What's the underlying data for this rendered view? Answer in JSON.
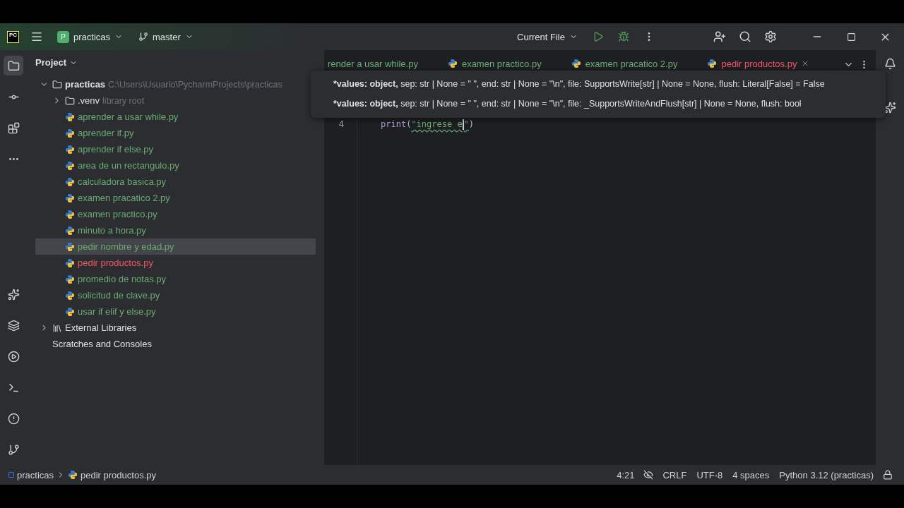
{
  "title_bar": {
    "logo": "PC",
    "project_badge": "P",
    "project": "practicas",
    "branch": "master",
    "run_config": "Current File"
  },
  "project_panel": {
    "title": "Project",
    "tree": [
      {
        "kind": "folder",
        "name": "practicas",
        "hint": "C:\\Users\\Usuario\\PycharmProjects\\practicas",
        "expanded": true,
        "selected": false,
        "children": [
          {
            "kind": "folder",
            "name": ".venv",
            "hint": "library root",
            "expanded": false,
            "selected": false
          },
          {
            "kind": "file",
            "name": "aprender a usar while.py",
            "color": "#6aab73",
            "selected": false
          },
          {
            "kind": "file",
            "name": "aprender if.py",
            "color": "#6aab73",
            "selected": false
          },
          {
            "kind": "file",
            "name": "aprender if else.py",
            "color": "#6aab73",
            "selected": false
          },
          {
            "kind": "file",
            "name": "area de un rectangulo.py",
            "color": "#6aab73",
            "selected": false
          },
          {
            "kind": "file",
            "name": "calculadora basica.py",
            "color": "#6aab73",
            "selected": false
          },
          {
            "kind": "file",
            "name": "examen pracatico 2.py",
            "color": "#6aab73",
            "selected": false
          },
          {
            "kind": "file",
            "name": "examen practico.py",
            "color": "#6aab73",
            "selected": false
          },
          {
            "kind": "file",
            "name": "minuto a hora.py",
            "color": "#6aab73",
            "selected": false
          },
          {
            "kind": "file",
            "name": "pedir nombre y edad.py",
            "color": "#6aab73",
            "selected": true
          },
          {
            "kind": "file",
            "name": "pedir productos.py",
            "color": "#f75464",
            "selected": false
          },
          {
            "kind": "file",
            "name": "promedio de notas.py",
            "color": "#6aab73",
            "selected": false
          },
          {
            "kind": "file",
            "name": "solicitud de clave.py",
            "color": "#6aab73",
            "selected": false
          },
          {
            "kind": "file",
            "name": "usar if elif y else.py",
            "color": "#6aab73",
            "selected": false
          }
        ]
      },
      {
        "kind": "library",
        "name": "External Libraries",
        "expanded": false,
        "selected": false
      },
      {
        "kind": "scratch",
        "name": "Scratches and Consoles",
        "selected": false
      }
    ]
  },
  "tabs": [
    {
      "label": "render a usar while.py",
      "icon": false,
      "selected": false,
      "color": "#6aab73"
    },
    {
      "label": "examen practico.py",
      "icon": true,
      "selected": false,
      "color": "#6aab73"
    },
    {
      "label": "examen pracatico 2.py",
      "icon": true,
      "selected": false,
      "color": "#6aab73"
    },
    {
      "label": "pedir productos.py",
      "icon": true,
      "selected": true,
      "color": "#f75464"
    }
  ],
  "parameter_hints": [
    {
      "bold": "*values: object,",
      "rest": " sep: str | None = \" \", end: str | None = \"\\n\", file: SupportsWrite[str] | None = None, flush: Literal[False] = False"
    },
    {
      "bold": "*values: object,",
      "rest": " sep: str | None = \" \", end: str | None = \"\\n\", file: _SupportsWriteAndFlush[str] | None = None, flush: bool"
    }
  ],
  "editor": {
    "lines": [
      {
        "number": "4",
        "tokens": [
          {
            "kind": "builtin",
            "text": "print"
          },
          {
            "kind": "plain",
            "text": "("
          },
          {
            "kind": "string",
            "text": "\"ingrese e"
          },
          {
            "kind": "cursor"
          },
          {
            "kind": "string",
            "text": "\""
          },
          {
            "kind": "plain",
            "text": ")"
          }
        ]
      }
    ]
  },
  "status_bar": {
    "breadcrumbs": [
      "practicas",
      "pedir productos.py"
    ],
    "position": "4:21",
    "line_separator": "CRLF",
    "encoding": "UTF-8",
    "indent": "4 spaces",
    "interpreter": "Python 3.12 (practicas)"
  }
}
